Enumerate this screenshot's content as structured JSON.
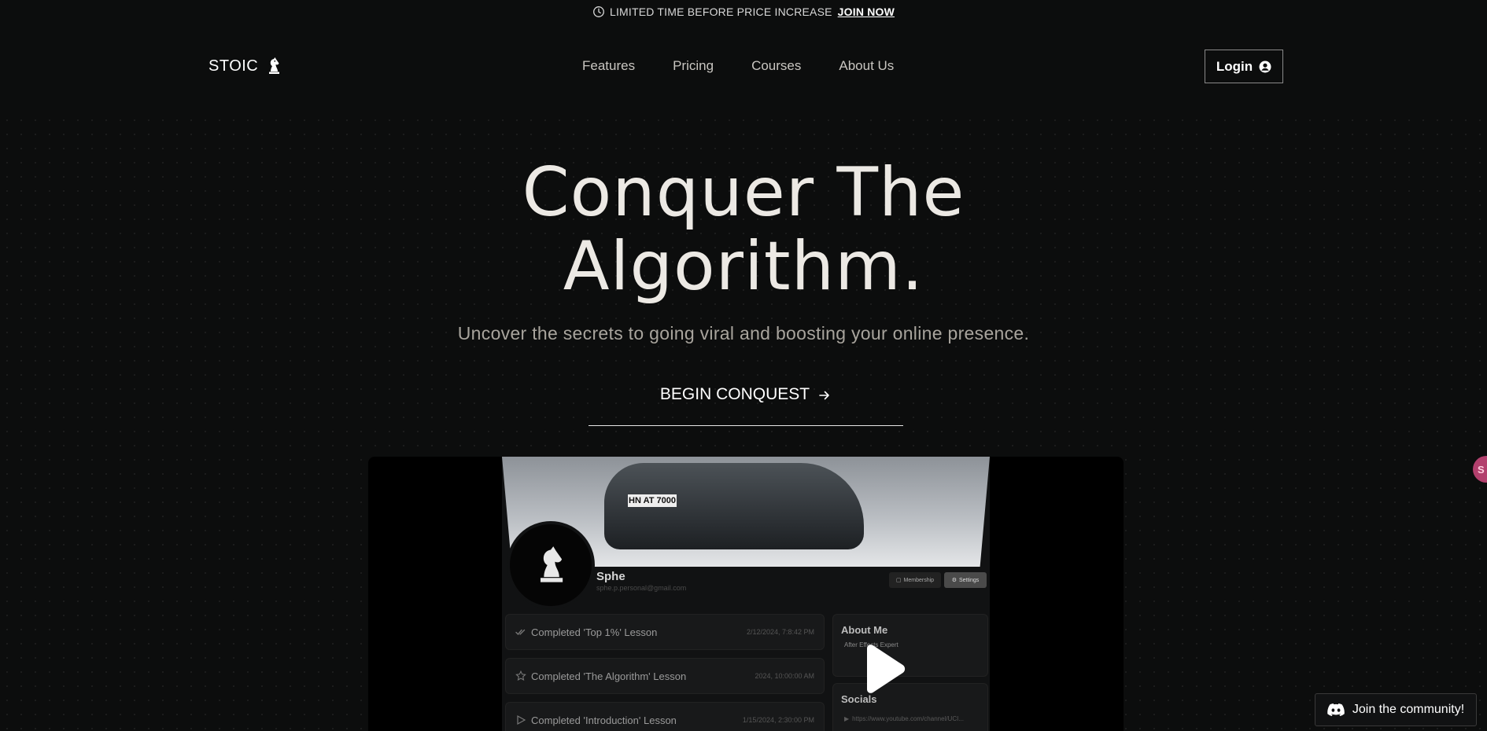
{
  "announcement": {
    "icon": "clock-icon",
    "text": "LIMITED TIME BEFORE PRICE INCREASE",
    "link": "JOIN NOW"
  },
  "nav": {
    "logo": "STOIC",
    "logo_icon": "chess-knight-icon",
    "links": [
      "Features",
      "Pricing",
      "Courses",
      "About Us"
    ],
    "login": "Login",
    "login_icon": "user-circle-icon"
  },
  "hero": {
    "title_line1": "Conquer The",
    "title_line2": "Algorithm.",
    "subtitle": "Uncover the secrets to going viral and boosting your online presence.",
    "cta": "BEGIN CONQUEST"
  },
  "video": {
    "plate": "HN AT 7000",
    "profile_name": "Sphe",
    "profile_email": "sphe.p.personal@gmail.com",
    "membership_btn": "Membership",
    "settings_btn": "Settings",
    "activities": [
      {
        "label": "Completed 'Top 1%' Lesson",
        "time": "2/12/2024, 7:8:42 PM"
      },
      {
        "label": "Completed 'The Algorithm' Lesson",
        "time": "2024, 10:00:00 AM"
      },
      {
        "label": "Completed 'Introduction' Lesson",
        "time": "1/15/2024, 2:30:00 PM"
      }
    ],
    "about_title": "About Me",
    "about_text": "After Effects Expert",
    "socials_title": "Socials",
    "socials_link": "https://www.youtube.com/channel/UCI..."
  },
  "floating_badge": "S",
  "community_button": "Join the community!",
  "colors": {
    "background": "#0c0d0d",
    "accent_pink": "#b2406d"
  }
}
